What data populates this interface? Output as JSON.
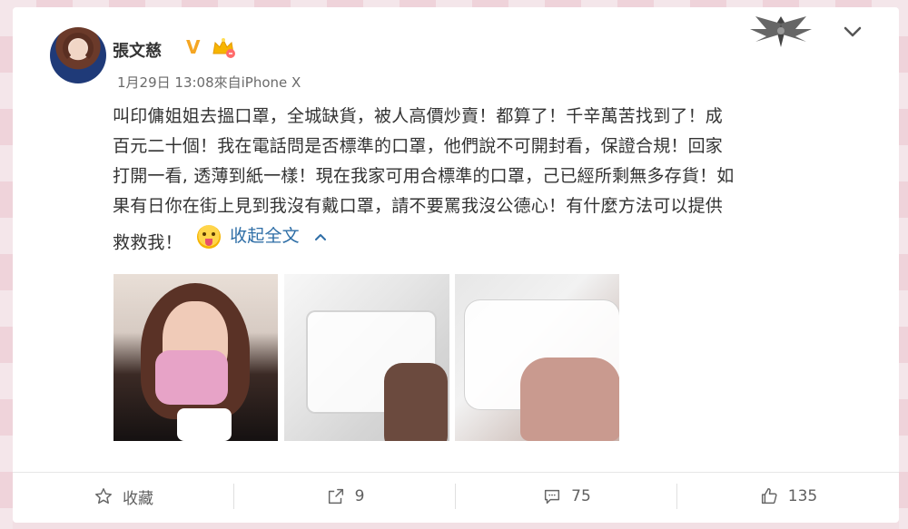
{
  "post": {
    "author_name": "張文慈",
    "verified_badge": "V",
    "meta": "1月29日 13:08來自iPhone X",
    "content_lines": [
      "叫印傭姐姐去搵口罩，全城缺貨，被人高價炒賣！都算了！千辛萬苦找到了！成",
      "百元二十個！我在電話問是否標準的口罩，他們說不可開封看，保證合規！回家",
      "打開一看, 透薄到紙一樣！現在我家可用合標準的口罩，己已經所剩無多存貨！如",
      "果有日你在街上見到我沒有戴口罩，請不要罵我沒公德心！有什麼方法可以提供",
      "救救我！"
    ],
    "collapse_label": "收起全文",
    "images": [
      {
        "icon": "photo"
      },
      {
        "icon": "photo"
      },
      {
        "icon": "photo"
      }
    ]
  },
  "actions": {
    "favorite_label": "收藏",
    "share_count": "9",
    "comment_count": "75",
    "like_count": "135"
  },
  "colors": {
    "link": "#2e6ea6",
    "verified": "#f5a623",
    "text": "#333333",
    "meta": "#6b6b6b"
  }
}
